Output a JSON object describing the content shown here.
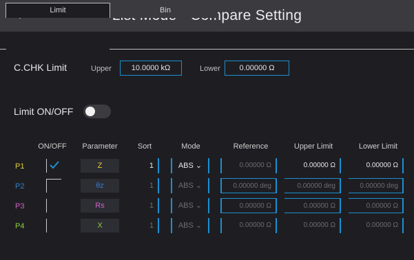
{
  "header": {
    "title": "List Mode - Compare Setting",
    "back_icon": "back-arrow-icon"
  },
  "tabs": [
    {
      "label": "Limit",
      "active": true
    },
    {
      "label": "Bin",
      "active": false
    }
  ],
  "cchk": {
    "label": "C.CHK Limit",
    "upper_label": "Upper",
    "upper_value": "10.0000 kΩ",
    "lower_label": "Lower",
    "lower_value": "0.00000 Ω"
  },
  "limit_toggle": {
    "label": "Limit ON/OFF",
    "on": false
  },
  "table": {
    "headers": [
      "ON/OFF",
      "Parameter",
      "Sort",
      "Mode",
      "Reference",
      "Upper Limit",
      "Lower Limit"
    ],
    "rows": [
      {
        "name": "P1",
        "name_color": "#e3d03a",
        "checked": true,
        "param": "Z",
        "param_color": "#e3d03a",
        "sort": "1",
        "mode": "ABS",
        "reference": "0.00000 Ω",
        "upper": "0.00000 Ω",
        "lower": "0.00000 Ω"
      },
      {
        "name": "P2",
        "name_color": "#2f7fd0",
        "checked": false,
        "param": "θz",
        "param_color": "#2f7fd0",
        "sort": "1",
        "mode": "ABS",
        "reference": "0.00000 deg",
        "upper": "0.00000 deg",
        "lower": "0.00000 deg"
      },
      {
        "name": "P3",
        "name_color": "#d062c9",
        "checked": false,
        "param": "Rs",
        "param_color": "#d062c9",
        "sort": "1",
        "mode": "ABS",
        "reference": "0.00000 Ω",
        "upper": "0.00000 Ω",
        "lower": "0.00000 Ω"
      },
      {
        "name": "P4",
        "name_color": "#8fcf3a",
        "checked": false,
        "param": "X",
        "param_color": "#8fcf3a",
        "sort": "1",
        "mode": "ABS",
        "reference": "0.00000 Ω",
        "upper": "0.00000 Ω",
        "lower": "0.00000 Ω"
      }
    ]
  },
  "colors": {
    "accent": "#1d8fd3",
    "background": "#1e1e22",
    "titlebar": "#3a3a3f"
  }
}
